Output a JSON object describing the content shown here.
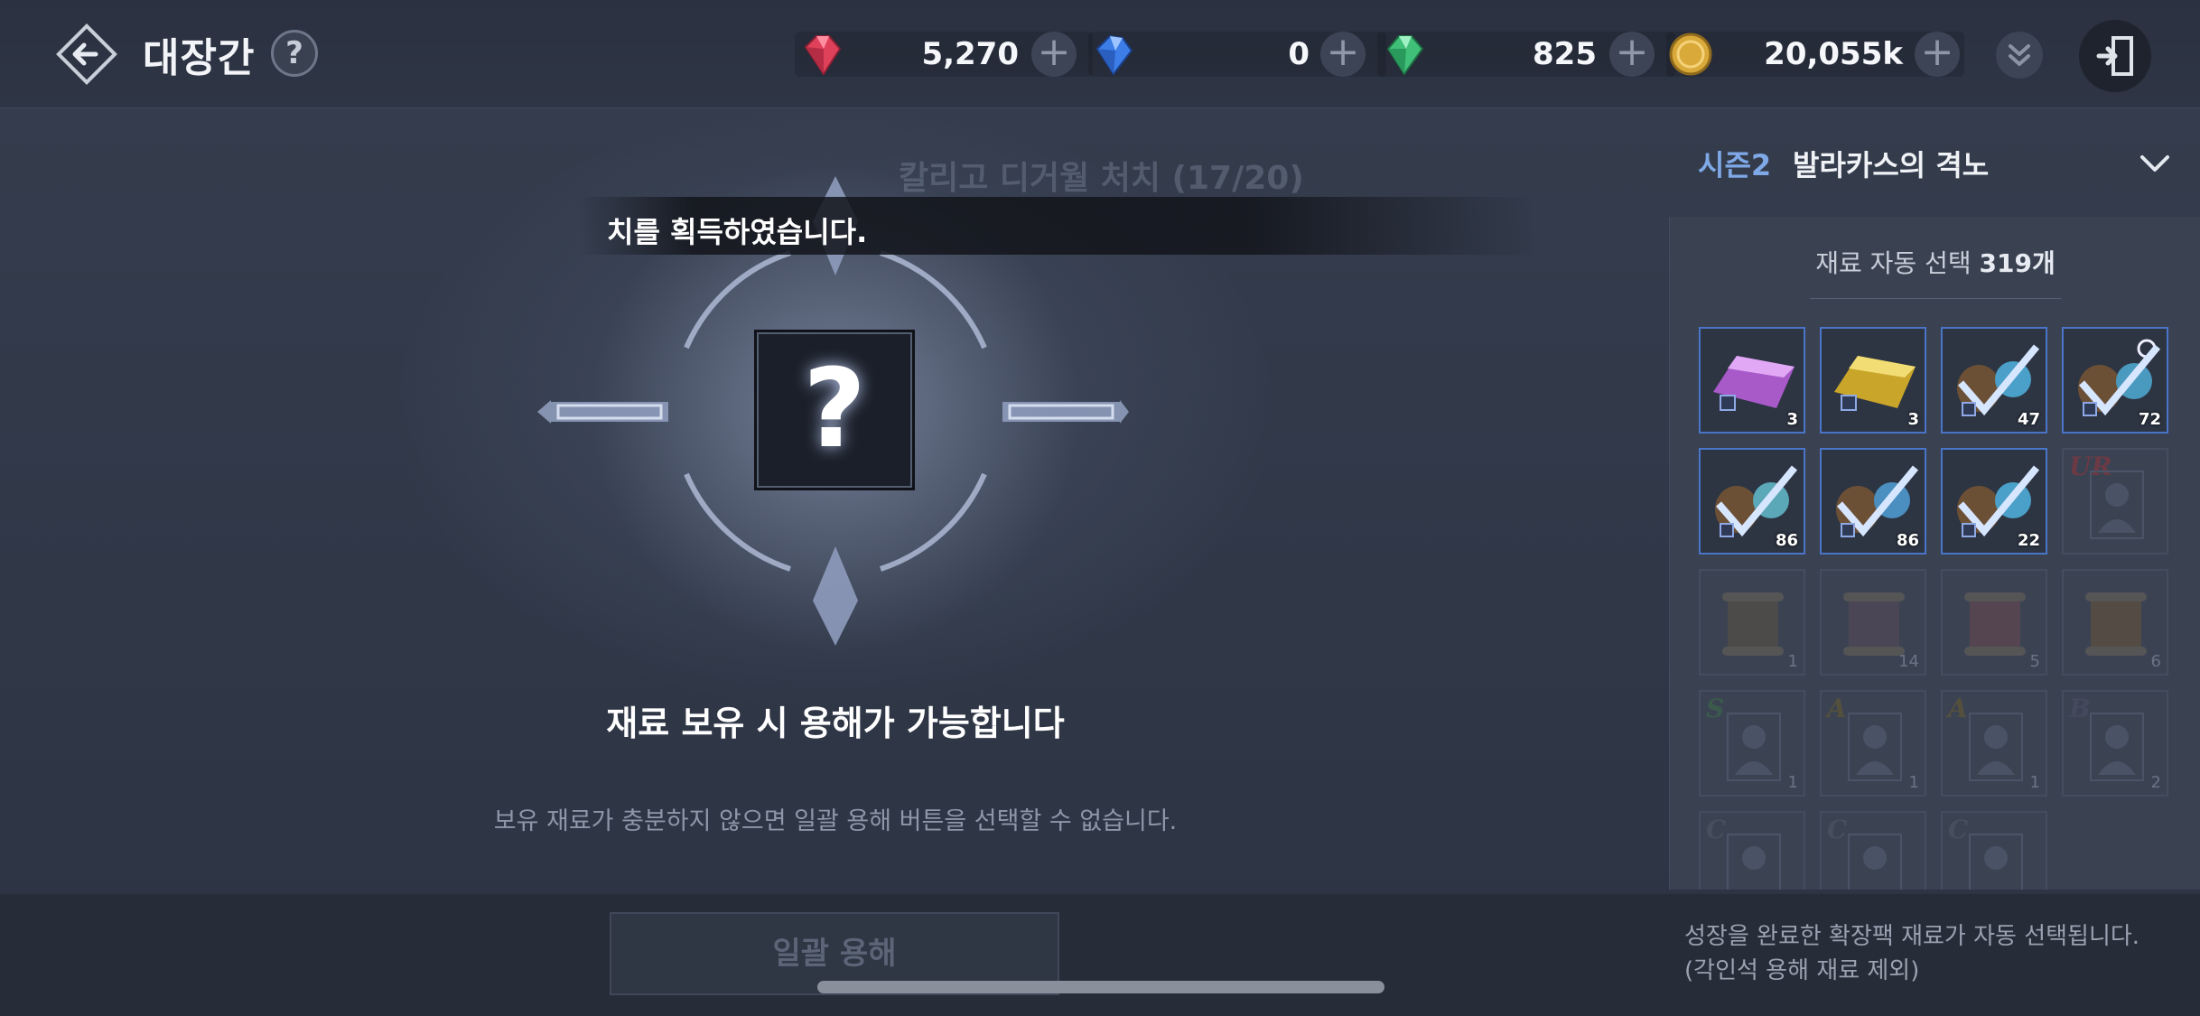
{
  "header": {
    "title": "대장간",
    "currencies": [
      {
        "name": "red-gem",
        "value": "5,270",
        "color": "#e0415a"
      },
      {
        "name": "blue-gem",
        "value": "0",
        "color": "#3c7de8"
      },
      {
        "name": "green-gem",
        "value": "825",
        "color": "#3fbf78"
      },
      {
        "name": "gold-coin",
        "value": "20,055k",
        "color": "#d9a93a"
      }
    ],
    "plus_label": "+"
  },
  "main": {
    "quest_text": "칼리고 디거월 처치 (17/20)",
    "toast": "치를 획득하였습니다.",
    "slot_placeholder": "?",
    "status_main": "재료 보유 시 용해가 가능합니다",
    "status_sub": "보유 재료가 충분하지 않으면 일괄 용해 버튼을 선택할 수 없습니다."
  },
  "footer": {
    "bulk_button": "일괄 용해",
    "note_line1": "성장을 완료한 확장팩 재료가 자동 선택됩니다.",
    "note_line2": "(각인석 용해 재료 제외)"
  },
  "side": {
    "season_tag": "시즌2",
    "season_name": "발라카스의 격노",
    "auto_label": "재료 자동 선택",
    "auto_count": "319개",
    "items": [
      {
        "icon": "purple-ingot-icon",
        "count": "3",
        "selected": true
      },
      {
        "icon": "gold-ingot-icon",
        "count": "3",
        "selected": true
      },
      {
        "icon": "material-bag-icon",
        "count": "47",
        "selected": true
      },
      {
        "icon": "material-bag-icon",
        "count": "72",
        "selected": true
      },
      {
        "icon": "material-bag-icon",
        "count": "86",
        "selected": true
      },
      {
        "icon": "material-bag-icon",
        "count": "86",
        "selected": true
      },
      {
        "icon": "material-bag-icon",
        "count": "22",
        "selected": true
      },
      {
        "icon": "character-card-icon",
        "count": "",
        "grade": "UR",
        "selected": false
      },
      {
        "icon": "scroll-icon",
        "count": "1",
        "selected": false
      },
      {
        "icon": "scroll-icon",
        "count": "14",
        "selected": false
      },
      {
        "icon": "scroll-icon",
        "count": "5",
        "selected": false
      },
      {
        "icon": "scroll-icon",
        "count": "6",
        "selected": false
      },
      {
        "icon": "character-card-icon",
        "count": "1",
        "grade": "S",
        "selected": false
      },
      {
        "icon": "character-card-icon",
        "count": "1",
        "grade": "A",
        "selected": false
      },
      {
        "icon": "character-card-icon",
        "count": "1",
        "grade": "A",
        "selected": false
      },
      {
        "icon": "character-card-icon",
        "count": "2",
        "grade": "B",
        "selected": false
      },
      {
        "icon": "character-card-icon",
        "count": "",
        "grade": "C",
        "selected": false
      },
      {
        "icon": "character-card-icon",
        "count": "",
        "grade": "C",
        "selected": false
      },
      {
        "icon": "character-card-icon",
        "count": "",
        "grade": "C",
        "selected": false
      }
    ]
  }
}
